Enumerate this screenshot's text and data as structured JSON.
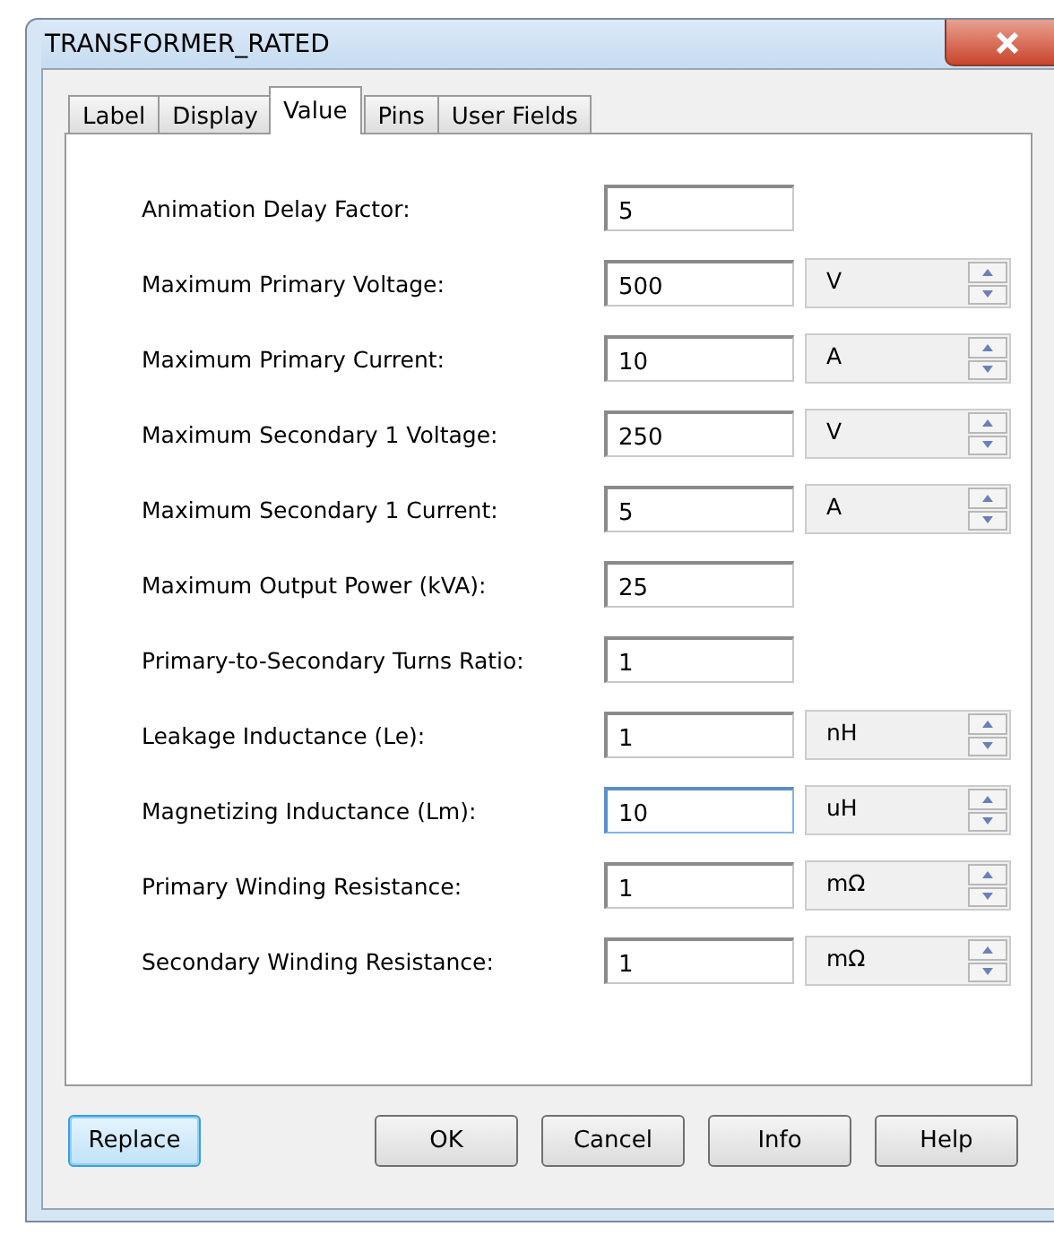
{
  "window": {
    "title": "TRANSFORMER_RATED"
  },
  "tabs": [
    {
      "label": "Label",
      "selected": false
    },
    {
      "label": "Display",
      "selected": false
    },
    {
      "label": "Value",
      "selected": true
    },
    {
      "label": "Pins",
      "selected": false
    },
    {
      "label": "User Fields",
      "selected": false
    }
  ],
  "fields": [
    {
      "label": "Animation Delay Factor:",
      "value": "5",
      "focused": false
    },
    {
      "label": "Maximum Primary Voltage:",
      "value": "500",
      "unit": "V",
      "focused": false
    },
    {
      "label": "Maximum Primary Current:",
      "value": "10",
      "unit": "A",
      "focused": false
    },
    {
      "label": "Maximum Secondary 1 Voltage:",
      "value": "250",
      "unit": "V",
      "focused": false
    },
    {
      "label": "Maximum Secondary 1 Current:",
      "value": "5",
      "unit": "A",
      "focused": false
    },
    {
      "label": "Maximum Output Power (kVA):",
      "value": "25",
      "focused": false
    },
    {
      "label": "Primary-to-Secondary Turns Ratio:",
      "value": "1",
      "focused": false
    },
    {
      "label": "Leakage Inductance (Le):",
      "value": "1",
      "unit": "nH",
      "focused": false
    },
    {
      "label": "Magnetizing Inductance (Lm):",
      "value": "10",
      "unit": "uH",
      "focused": true
    },
    {
      "label": "Primary Winding Resistance:",
      "value": "1",
      "unit": "mΩ",
      "focused": false
    },
    {
      "label": "Secondary Winding Resistance:",
      "value": "1",
      "unit": "mΩ",
      "focused": false
    }
  ],
  "buttons": [
    {
      "label": "Replace",
      "default": true
    },
    {
      "label": "OK",
      "default": false
    },
    {
      "label": "Cancel",
      "default": false
    },
    {
      "label": "Info",
      "default": false
    },
    {
      "label": "Help",
      "default": false
    }
  ]
}
